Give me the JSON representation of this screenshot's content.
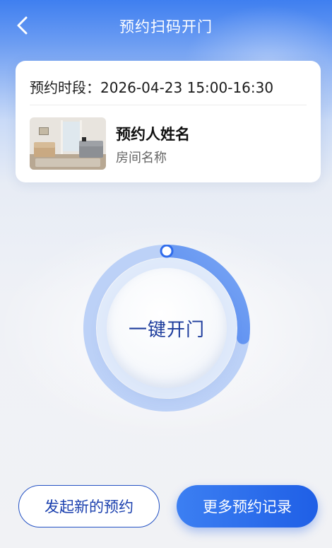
{
  "header": {
    "title": "预约扫码开门",
    "back_icon": "chevron-left-icon"
  },
  "appointment": {
    "time_label": "预约时段：",
    "time_value": "2026-04-23 15:00-16:30",
    "booker_name": "预约人姓名",
    "room_name": "房间名称"
  },
  "door": {
    "label": "一键开门",
    "ring_progress": 0.27
  },
  "actions": {
    "new_booking": "发起新的预约",
    "more_records": "更多预约记录"
  },
  "colors": {
    "primary": "#2f6cec",
    "primary_dark": "#1d3c9c",
    "outline": "#2452c4"
  }
}
